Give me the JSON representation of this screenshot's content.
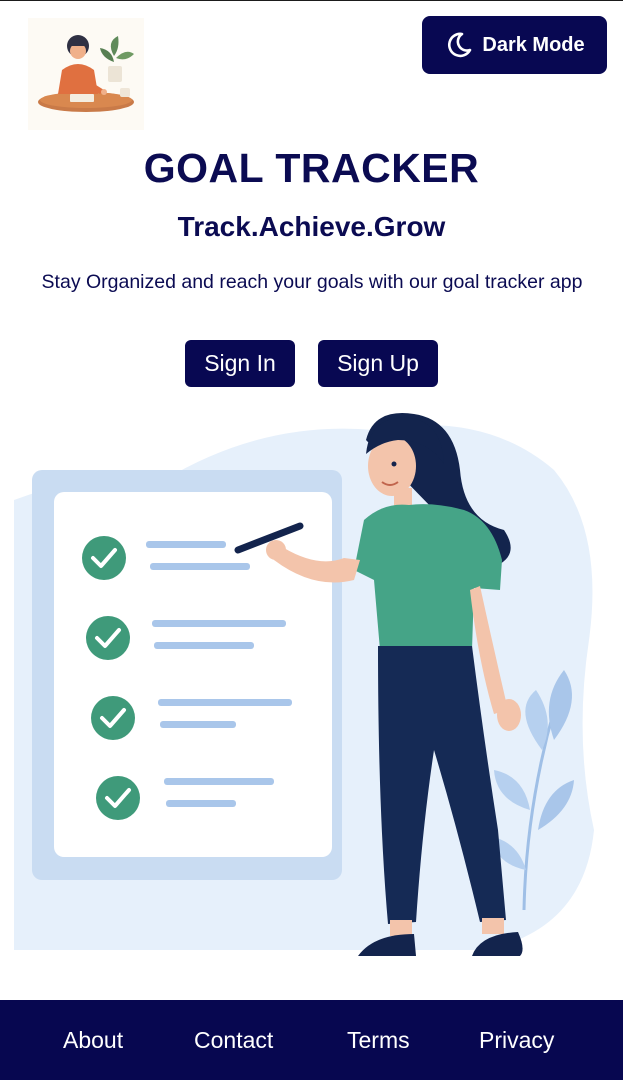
{
  "header": {
    "dark_mode_label": "Dark Mode",
    "dark_mode_icon": "moon-icon",
    "logo_icon": "woman-writing-logo"
  },
  "hero": {
    "title": "GOAL TRACKER",
    "tagline": "Track.Achieve.Grow",
    "description": "Stay Organized and reach your goals with our goal tracker app",
    "sign_in_label": "Sign In",
    "sign_up_label": "Sign Up",
    "illustration": "woman-checklist-illustration"
  },
  "footer": {
    "links": [
      {
        "label": "About"
      },
      {
        "label": "Contact"
      },
      {
        "label": "Terms"
      },
      {
        "label": "Privacy"
      }
    ]
  },
  "colors": {
    "primary": "#080852",
    "footer": "#070750",
    "check_green": "#3f9a7a",
    "shirt_green": "#45a487",
    "pants_navy": "#152a55",
    "board_blue": "#c9dcf2"
  }
}
